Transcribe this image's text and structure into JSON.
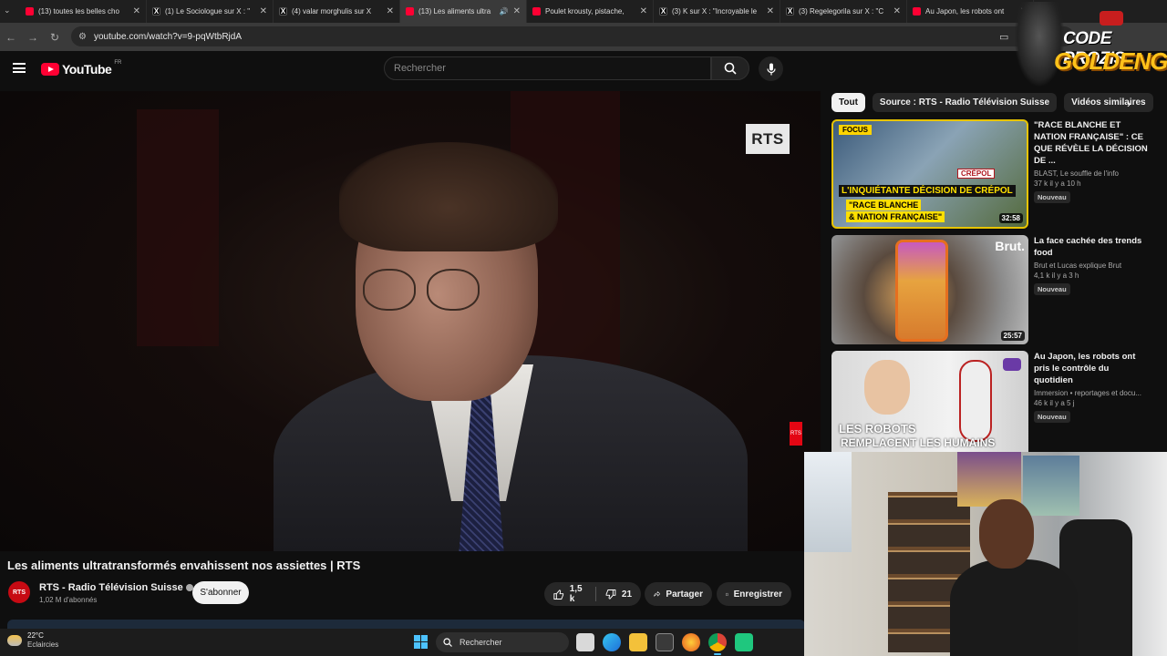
{
  "browser": {
    "tabs": [
      {
        "label": "(13) toutes les belles cho",
        "icon": "youtube-icon",
        "active": false
      },
      {
        "label": "(1) Le Sociologue sur X : \"",
        "icon": "x-icon",
        "active": false
      },
      {
        "label": "(4) valar morghulis sur X",
        "icon": "x-icon",
        "active": false
      },
      {
        "label": "(13) Les aliments ultra",
        "icon": "youtube-icon",
        "active": true
      },
      {
        "label": "Poulet krousty, pistache, ",
        "icon": "youtube-icon",
        "active": false
      },
      {
        "label": "(3) K sur X : \"Incroyable le",
        "icon": "x-icon",
        "active": false
      },
      {
        "label": "(3) Regelegorila sur X : \"C",
        "icon": "x-icon",
        "active": false
      },
      {
        "label": "Au Japon, les robots ont ",
        "icon": "youtube-icon",
        "active": false
      }
    ],
    "url": "youtube.com/watch?v=9-pqWtbRjdA"
  },
  "youtube": {
    "logo_text": "YouTube",
    "region": "FR",
    "search_placeholder": "Rechercher"
  },
  "video": {
    "title": "Les aliments ultratransformés envahissent nos assiettes | RTS",
    "overlay_logo": "RTS",
    "side_logo": "RTS"
  },
  "channel": {
    "avatar_text": "RTS",
    "name": "RTS - Radio Télévision Suisse",
    "subscribers": "1,02 M d'abonnés",
    "subscribe_label": "S'abonner"
  },
  "actions": {
    "likes": "1,5 k",
    "dislikes": "21",
    "share_label": "Partager",
    "save_label": "Enregistrer"
  },
  "chips": [
    "Tout",
    "Source : RTS - Radio Télévision Suisse",
    "Vidéos similaires"
  ],
  "recommendations": [
    {
      "title": "\"RACE BLANCHE ET NATION FRANÇAISE\" : CE QUE RÉVÈLE LA DÉCISION DE ...",
      "channel": "BLAST, Le souffle de l'info",
      "stats": "37 k  il y a 10 h",
      "badge": "Nouveau",
      "duration": "32:58",
      "thumb_text": {
        "focus": "FOCUS",
        "line1": "L'INQUIÉTANTE DÉCISION DE CRÉPOL",
        "line2": "\"RACE BLANCHE",
        "line3": "& NATION FRANÇAISE\"",
        "sign": "CRÉPOL"
      }
    },
    {
      "title": "La face cachée des trends food",
      "channel": "Brut  et Lucas explique Brut",
      "stats": "4,1 k  il y a 3 h",
      "badge": "Nouveau",
      "duration": "25:57",
      "thumb_text": {
        "brand": "Brut."
      }
    },
    {
      "title": "Au Japon, les robots ont pris le contrôle du quotidien",
      "channel": "Immersion • reportages et docu...",
      "stats": "46 k  il y a 5 j",
      "badge": "Nouveau",
      "duration": "",
      "thumb_text": {
        "line1": "LES ROBOTS",
        "line2": "REMPLACENT LES HUMAINS"
      }
    }
  ],
  "watermark": {
    "line1": "CODE PROZIS",
    "line2": "GOLDENG"
  },
  "taskbar": {
    "temperature": "22°C",
    "condition": "Eclaircies",
    "search_label": "Rechercher"
  },
  "colors": {
    "yt_red": "#ff0033",
    "rts_red": "#e30613",
    "accent_blue": "#4cc2ff",
    "focus_yellow": "#ffd400"
  }
}
